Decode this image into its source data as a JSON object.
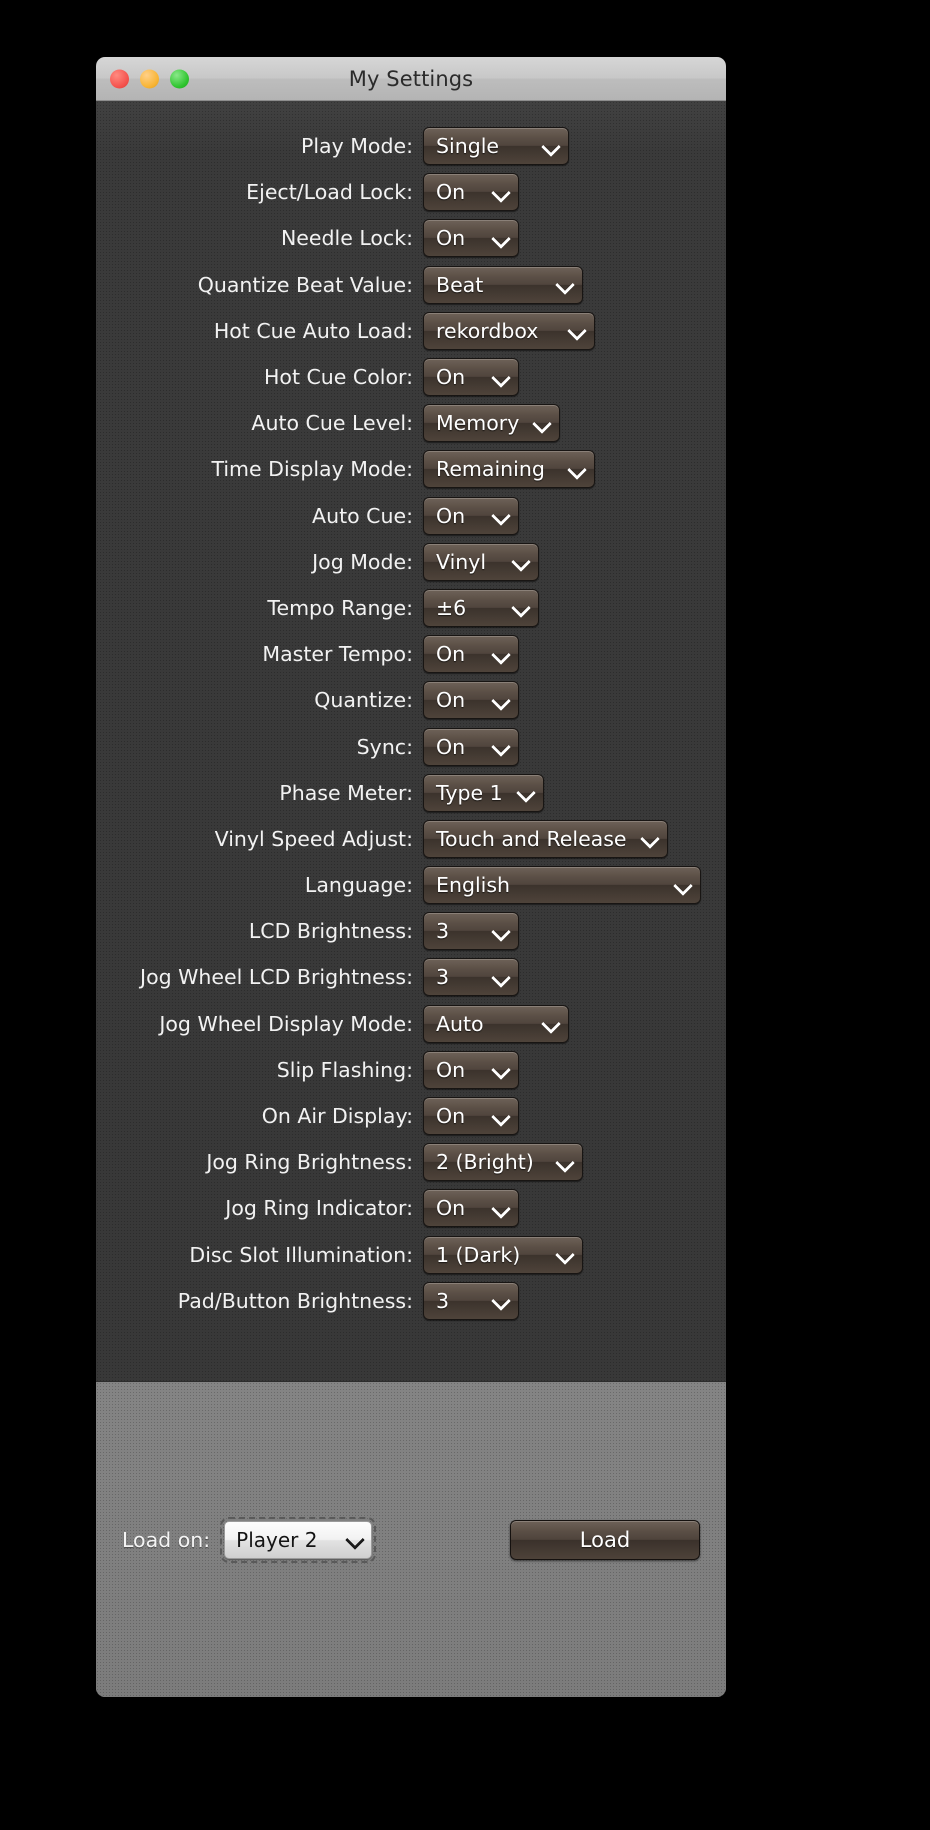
{
  "window": {
    "title": "My Settings",
    "traffic_lights": [
      {
        "name": "close",
        "color": "#f4524d"
      },
      {
        "name": "minimize",
        "color": "#f8b434"
      },
      {
        "name": "maximize",
        "color": "#2ec42e"
      }
    ]
  },
  "settings": {
    "rows": [
      {
        "label": "Play Mode:",
        "value": "Single",
        "width": "w-lg"
      },
      {
        "label": "Eject/Load Lock:",
        "value": "On",
        "width": "w-sm"
      },
      {
        "label": "Needle Lock:",
        "value": "On",
        "width": "w-sm"
      },
      {
        "label": "Quantize Beat Value:",
        "value": "Beat",
        "width": "w-xl"
      },
      {
        "label": "Hot Cue Auto Load:",
        "value": "rekordbox",
        "width": "w-xxl"
      },
      {
        "label": "Hot Cue Color:",
        "value": "On",
        "width": "w-sm"
      },
      {
        "label": "Auto Cue Level:",
        "value": "Memory",
        "width": "w-md"
      },
      {
        "label": "Time Display Mode:",
        "value": "Remaining",
        "width": "w-xxl"
      },
      {
        "label": "Auto Cue:",
        "value": "On",
        "width": "w-sm"
      },
      {
        "label": "Jog Mode:",
        "value": "Vinyl",
        "width": "w-md"
      },
      {
        "label": "Tempo Range:",
        "value": "±6",
        "width": "w-md"
      },
      {
        "label": "Master Tempo:",
        "value": "On",
        "width": "w-sm"
      },
      {
        "label": "Quantize:",
        "value": "On",
        "width": "w-sm"
      },
      {
        "label": "Sync:",
        "value": "On",
        "width": "w-sm"
      },
      {
        "label": "Phase Meter:",
        "value": "Type 1",
        "width": "w-md"
      },
      {
        "label": "Vinyl Speed Adjust:",
        "value": "Touch and Release",
        "width": "w-230"
      },
      {
        "label": "Language:",
        "value": "English",
        "width": "w-278"
      },
      {
        "label": "LCD Brightness:",
        "value": "3",
        "width": "w-sm"
      },
      {
        "label": "Jog Wheel LCD Brightness:",
        "value": "3",
        "width": "w-sm"
      },
      {
        "label": "Jog Wheel Display Mode:",
        "value": "Auto",
        "width": "w-lg"
      },
      {
        "label": "Slip Flashing:",
        "value": "On",
        "width": "w-sm"
      },
      {
        "label": "On Air Display:",
        "value": "On",
        "width": "w-sm"
      },
      {
        "label": "Jog Ring Brightness:",
        "value": "2 (Bright)",
        "width": "w-xl"
      },
      {
        "label": "Jog Ring Indicator:",
        "value": "On",
        "width": "w-sm"
      },
      {
        "label": "Disc Slot Illumination:",
        "value": "1 (Dark)",
        "width": "w-xl"
      },
      {
        "label": "Pad/Button Brightness:",
        "value": "3",
        "width": "w-sm"
      }
    ]
  },
  "footer": {
    "load_on_label": "Load on:",
    "player_value": "Player 2",
    "load_button_label": "Load"
  },
  "colors": {
    "desktop_background": "#000000",
    "panel_background": "#3a3a3a",
    "footer_background": "#7b7b7b",
    "titlebar_background": "#c8c8c8",
    "dropdown_accent": "#5c5047",
    "label_text": "#f2f2f2"
  }
}
